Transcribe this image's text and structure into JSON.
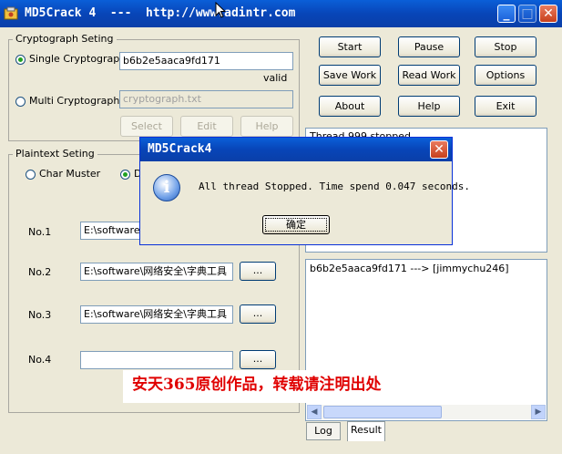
{
  "window": {
    "title": "MD5Crack 4  ---  http://www.adintr.com",
    "minimize": "_",
    "maximize": "□",
    "close": "✕"
  },
  "crypto_group": {
    "label": "Cryptograph Seting",
    "single_label": "Single Cryptograph",
    "single_value": "b6b2e5aaca9fd171",
    "valid_text": "valid",
    "multi_label": "Multi Cryptograph",
    "multi_placeholder": "cryptograph.txt",
    "select_label": "Select",
    "edit_label": "Edit",
    "help_label": "Help"
  },
  "plaintext_group": {
    "label": "Plaintext Seting",
    "char_muster_label": "Char Muster",
    "dict_label_partial": "D",
    "rows": [
      {
        "label": "No.1",
        "value": "E:\\software\\",
        "browse": "..."
      },
      {
        "label": "No.2",
        "value": "E:\\software\\网络安全\\字典工具",
        "browse": "..."
      },
      {
        "label": "No.3",
        "value": "E:\\software\\网络安全\\字典工具",
        "browse": "..."
      },
      {
        "label": "No.4",
        "value": "",
        "browse": "..."
      }
    ]
  },
  "buttons": {
    "start": "Start",
    "pause": "Pause",
    "stop": "Stop",
    "save_work": "Save Work",
    "read_work": "Read Work",
    "options": "Options",
    "about": "About",
    "help": "Help",
    "exit": "Exit"
  },
  "log_panel": {
    "first_line": "Thread 999 stopped"
  },
  "result_panel": {
    "line": "b6b2e5aaca9fd171 ---> [jimmychu246]"
  },
  "tabs": {
    "log": "Log",
    "result": "Result"
  },
  "dialog": {
    "title": "MD5Crack4",
    "message": "All thread Stopped. Time spend 0.047 seconds.",
    "ok_label": "确定",
    "icon_glyph": "i"
  },
  "watermark": "安天365原创作品，转载请注明出处"
}
